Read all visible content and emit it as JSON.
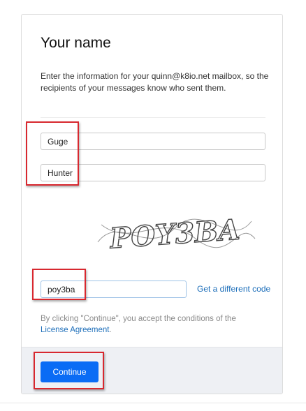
{
  "title": "Your name",
  "description": "Enter the information for your quinn@k8io.net mailbox, so the recipients of your messages know who sent them.",
  "form": {
    "first_name": "Guge",
    "last_name": "Hunter",
    "captcha_value": "poy3ba"
  },
  "captcha": {
    "image_text": "POY3BA",
    "different_code_link": "Get a different code"
  },
  "terms": {
    "prefix": "By clicking \"Continue\", you accept the conditions of the",
    "link": "License Agreement",
    "suffix": "."
  },
  "footer": {
    "continue_label": "Continue"
  },
  "colors": {
    "accent": "#0a6cf5",
    "link": "#1e6fba",
    "highlight": "#d8282f"
  }
}
